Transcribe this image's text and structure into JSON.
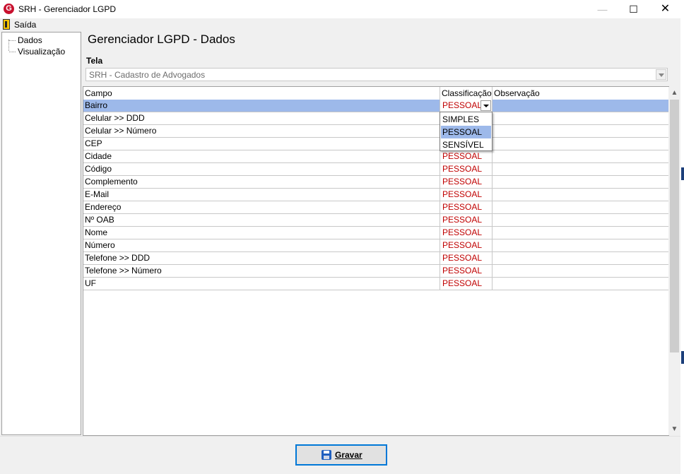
{
  "window": {
    "title": "SRH - Gerenciador LGPD",
    "icon": "app-logo-icon",
    "minimize_glyph": "—",
    "maximize_glyph": "☐",
    "close_glyph": "✕"
  },
  "menu": {
    "items": [
      {
        "label": "Saída",
        "icon": "exit-door-icon"
      }
    ]
  },
  "tree": {
    "items": [
      {
        "label": "Dados"
      },
      {
        "label": "Visualização"
      }
    ]
  },
  "page": {
    "title": "Gerenciador LGPD - Dados",
    "tela_label": "Tela",
    "tela_value": "SRH - Cadastro de Advogados"
  },
  "grid": {
    "columns": [
      "Campo",
      "Classificação",
      "Observação"
    ],
    "rows": [
      {
        "campo": "Bairro",
        "classificacao": "PESSOAL",
        "observacao": ""
      },
      {
        "campo": "Celular >> DDD",
        "classificacao": "",
        "observacao": ""
      },
      {
        "campo": "Celular >> Número",
        "classificacao": "",
        "observacao": ""
      },
      {
        "campo": "CEP",
        "classificacao": "",
        "observacao": ""
      },
      {
        "campo": "Cidade",
        "classificacao": "PESSOAL",
        "observacao": ""
      },
      {
        "campo": "Código",
        "classificacao": "PESSOAL",
        "observacao": ""
      },
      {
        "campo": "Complemento",
        "classificacao": "PESSOAL",
        "observacao": ""
      },
      {
        "campo": "E-Mail",
        "classificacao": "PESSOAL",
        "observacao": ""
      },
      {
        "campo": "Endereço",
        "classificacao": "PESSOAL",
        "observacao": ""
      },
      {
        "campo": "Nº OAB",
        "classificacao": "PESSOAL",
        "observacao": ""
      },
      {
        "campo": "Nome",
        "classificacao": "PESSOAL",
        "observacao": ""
      },
      {
        "campo": "Número",
        "classificacao": "PESSOAL",
        "observacao": ""
      },
      {
        "campo": "Telefone >> DDD",
        "classificacao": "PESSOAL",
        "observacao": ""
      },
      {
        "campo": "Telefone >> Número",
        "classificacao": "PESSOAL",
        "observacao": ""
      },
      {
        "campo": "UF",
        "classificacao": "PESSOAL",
        "observacao": ""
      }
    ],
    "selected_row": 0,
    "classification_options": [
      "SIMPLES",
      "PESSOAL",
      "SENSÍVEL"
    ],
    "highlighted_option": 1
  },
  "scroll": {
    "up_glyph": "▲",
    "down_glyph": "▼"
  },
  "footer": {
    "save_label": "Gravar",
    "save_icon": "floppy-disk-icon"
  },
  "colors": {
    "selection": "#9db9ea",
    "classification_text": "#c00000",
    "app_icon": "#c8102e",
    "button_border": "#0078d7"
  }
}
